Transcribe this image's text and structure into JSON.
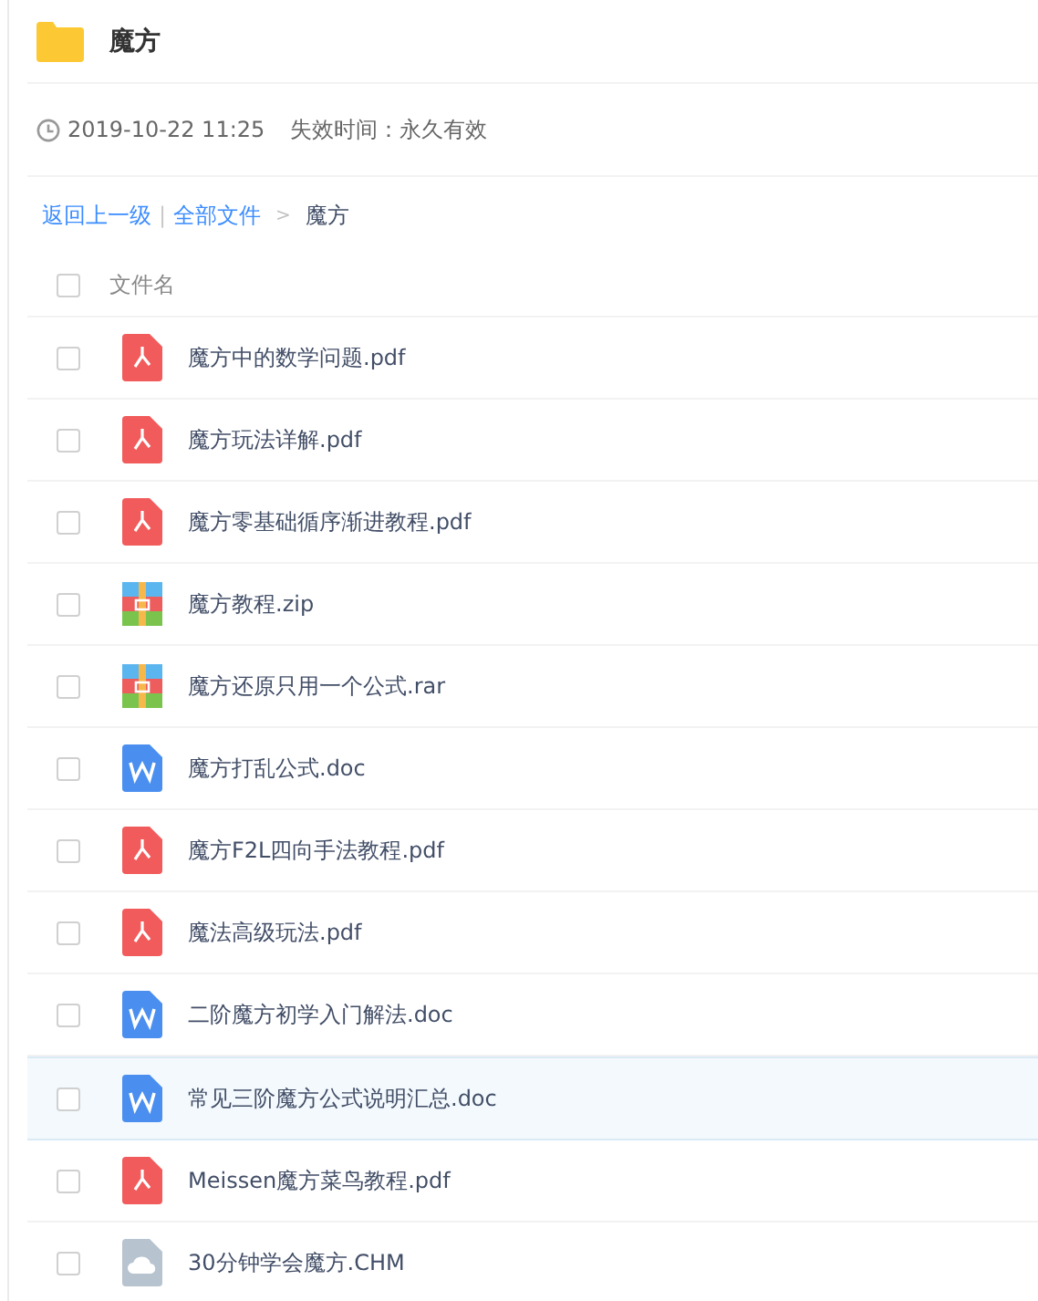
{
  "folder": {
    "title": "魔方"
  },
  "meta": {
    "date": "2019-10-22 11:25",
    "expiry": "失效时间：永久有效"
  },
  "breadcrumb": {
    "back": "返回上一级",
    "separator": "|",
    "root": "全部文件",
    "arrow": ">",
    "current": "魔方"
  },
  "table": {
    "header": {
      "label": "文件名",
      "checked": false
    },
    "rows": [
      {
        "name": "魔方中的数学问题.pdf",
        "kind": "pdf",
        "checked": false,
        "highlighted": false
      },
      {
        "name": "魔方玩法详解.pdf",
        "kind": "pdf",
        "checked": false,
        "highlighted": false
      },
      {
        "name": "魔方零基础循序渐进教程.pdf",
        "kind": "pdf",
        "checked": false,
        "highlighted": false
      },
      {
        "name": "魔方教程.zip",
        "kind": "archive",
        "checked": false,
        "highlighted": false
      },
      {
        "name": "魔方还原只用一个公式.rar",
        "kind": "archive",
        "checked": false,
        "highlighted": false
      },
      {
        "name": "魔方打乱公式.doc",
        "kind": "doc",
        "checked": false,
        "highlighted": false
      },
      {
        "name": "魔方F2L四向手法教程.pdf",
        "kind": "pdf",
        "checked": false,
        "highlighted": false
      },
      {
        "name": "魔法高级玩法.pdf",
        "kind": "pdf",
        "checked": false,
        "highlighted": false
      },
      {
        "name": "二阶魔方初学入门解法.doc",
        "kind": "doc",
        "checked": false,
        "highlighted": false
      },
      {
        "name": "常见三阶魔方公式说明汇总.doc",
        "kind": "doc",
        "checked": false,
        "highlighted": true
      },
      {
        "name": "Meissen魔方菜鸟教程.pdf",
        "kind": "pdf",
        "checked": false,
        "highlighted": false
      },
      {
        "name": "30分钟学会魔方.CHM",
        "kind": "other",
        "checked": false,
        "highlighted": false
      }
    ]
  }
}
